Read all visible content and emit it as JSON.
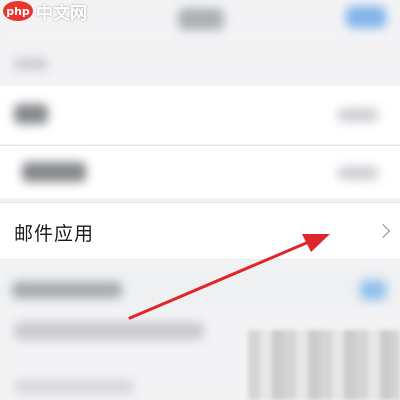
{
  "watermark": {
    "logo_text": "php",
    "text": "中文网"
  },
  "settings_list": {
    "mail_app": {
      "label": "邮件应用",
      "chevron_icon": "chevron-right-icon"
    }
  },
  "annotation": {
    "arrow_color": "#e0262b"
  }
}
